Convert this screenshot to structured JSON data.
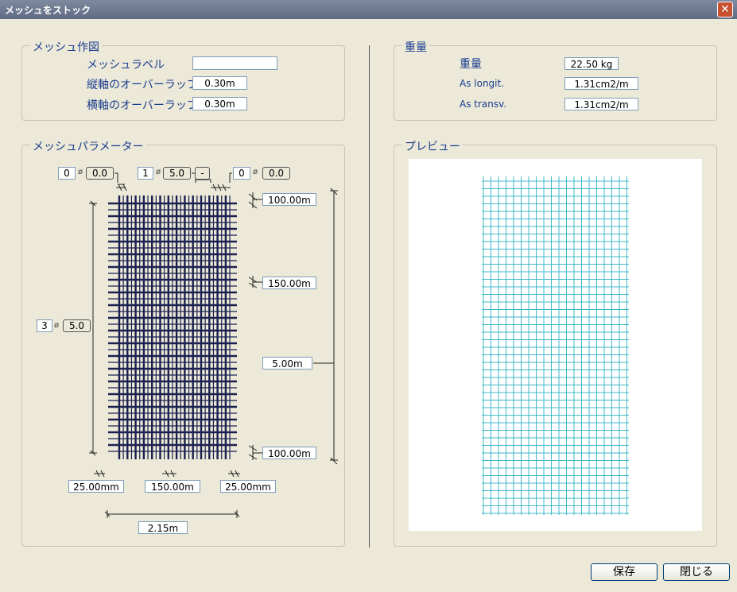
{
  "window": {
    "title": "メッシュをストック",
    "close_label": "✕"
  },
  "mesh_drawing": {
    "legend": "メッシュ作図",
    "label_caption": "メッシュラベル",
    "label_value": "",
    "vertical_overlap_caption": "縦軸のオーバーラップ",
    "vertical_overlap_value": "0.30m",
    "horizontal_overlap_caption": "横軸のオーバーラップ",
    "horizontal_overlap_value": "0.30m"
  },
  "weight": {
    "legend": "重量",
    "weight_caption": "重量",
    "weight_value": "22.50 kg",
    "as_longit_caption": "As longit.",
    "as_longit_value": "1.31cm2/m",
    "as_transv_caption": "As transv.",
    "as_transv_value": "1.31cm2/m"
  },
  "params": {
    "legend": "メッシュパラメーター",
    "top_left_count": "0",
    "top_left_dia": "0.0",
    "top_mid_count": "1",
    "top_mid_dia": "5.0",
    "top_mid_minus": "-",
    "top_right_count": "0",
    "top_right_dia": "0.0",
    "left_count": "3",
    "left_dia": "5.0",
    "phi": "ø",
    "right_top": "100.00m",
    "right_mid": "150.00m",
    "right_total": "5.00m",
    "right_bottom": "100.00m",
    "bottom_left": "25.00mm",
    "bottom_mid": "150.00m",
    "bottom_right": "25.00mm",
    "bottom_total": "2.15m"
  },
  "preview": {
    "legend": "プレビュー",
    "grid_color": "#3fb8c8"
  },
  "buttons": {
    "save": "保存",
    "close": "閉じる"
  },
  "colors": {
    "accent": "#1a3d8f",
    "mesh": "#1a2050"
  }
}
